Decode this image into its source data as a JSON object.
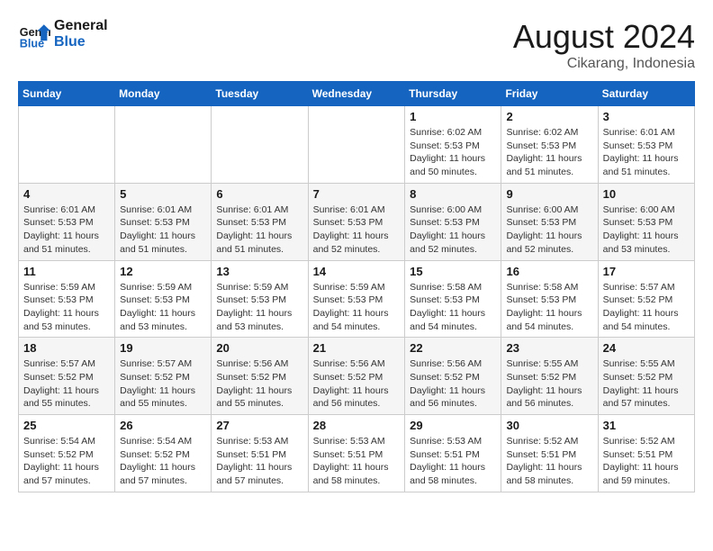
{
  "header": {
    "logo_line1": "General",
    "logo_line2": "Blue",
    "month_year": "August 2024",
    "location": "Cikarang, Indonesia"
  },
  "weekdays": [
    "Sunday",
    "Monday",
    "Tuesday",
    "Wednesday",
    "Thursday",
    "Friday",
    "Saturday"
  ],
  "weeks": [
    [
      {
        "day": "",
        "info": ""
      },
      {
        "day": "",
        "info": ""
      },
      {
        "day": "",
        "info": ""
      },
      {
        "day": "",
        "info": ""
      },
      {
        "day": "1",
        "info": "Sunrise: 6:02 AM\nSunset: 5:53 PM\nDaylight: 11 hours and 50 minutes."
      },
      {
        "day": "2",
        "info": "Sunrise: 6:02 AM\nSunset: 5:53 PM\nDaylight: 11 hours and 51 minutes."
      },
      {
        "day": "3",
        "info": "Sunrise: 6:01 AM\nSunset: 5:53 PM\nDaylight: 11 hours and 51 minutes."
      }
    ],
    [
      {
        "day": "4",
        "info": "Sunrise: 6:01 AM\nSunset: 5:53 PM\nDaylight: 11 hours and 51 minutes."
      },
      {
        "day": "5",
        "info": "Sunrise: 6:01 AM\nSunset: 5:53 PM\nDaylight: 11 hours and 51 minutes."
      },
      {
        "day": "6",
        "info": "Sunrise: 6:01 AM\nSunset: 5:53 PM\nDaylight: 11 hours and 51 minutes."
      },
      {
        "day": "7",
        "info": "Sunrise: 6:01 AM\nSunset: 5:53 PM\nDaylight: 11 hours and 52 minutes."
      },
      {
        "day": "8",
        "info": "Sunrise: 6:00 AM\nSunset: 5:53 PM\nDaylight: 11 hours and 52 minutes."
      },
      {
        "day": "9",
        "info": "Sunrise: 6:00 AM\nSunset: 5:53 PM\nDaylight: 11 hours and 52 minutes."
      },
      {
        "day": "10",
        "info": "Sunrise: 6:00 AM\nSunset: 5:53 PM\nDaylight: 11 hours and 53 minutes."
      }
    ],
    [
      {
        "day": "11",
        "info": "Sunrise: 5:59 AM\nSunset: 5:53 PM\nDaylight: 11 hours and 53 minutes."
      },
      {
        "day": "12",
        "info": "Sunrise: 5:59 AM\nSunset: 5:53 PM\nDaylight: 11 hours and 53 minutes."
      },
      {
        "day": "13",
        "info": "Sunrise: 5:59 AM\nSunset: 5:53 PM\nDaylight: 11 hours and 53 minutes."
      },
      {
        "day": "14",
        "info": "Sunrise: 5:59 AM\nSunset: 5:53 PM\nDaylight: 11 hours and 54 minutes."
      },
      {
        "day": "15",
        "info": "Sunrise: 5:58 AM\nSunset: 5:53 PM\nDaylight: 11 hours and 54 minutes."
      },
      {
        "day": "16",
        "info": "Sunrise: 5:58 AM\nSunset: 5:53 PM\nDaylight: 11 hours and 54 minutes."
      },
      {
        "day": "17",
        "info": "Sunrise: 5:57 AM\nSunset: 5:52 PM\nDaylight: 11 hours and 54 minutes."
      }
    ],
    [
      {
        "day": "18",
        "info": "Sunrise: 5:57 AM\nSunset: 5:52 PM\nDaylight: 11 hours and 55 minutes."
      },
      {
        "day": "19",
        "info": "Sunrise: 5:57 AM\nSunset: 5:52 PM\nDaylight: 11 hours and 55 minutes."
      },
      {
        "day": "20",
        "info": "Sunrise: 5:56 AM\nSunset: 5:52 PM\nDaylight: 11 hours and 55 minutes."
      },
      {
        "day": "21",
        "info": "Sunrise: 5:56 AM\nSunset: 5:52 PM\nDaylight: 11 hours and 56 minutes."
      },
      {
        "day": "22",
        "info": "Sunrise: 5:56 AM\nSunset: 5:52 PM\nDaylight: 11 hours and 56 minutes."
      },
      {
        "day": "23",
        "info": "Sunrise: 5:55 AM\nSunset: 5:52 PM\nDaylight: 11 hours and 56 minutes."
      },
      {
        "day": "24",
        "info": "Sunrise: 5:55 AM\nSunset: 5:52 PM\nDaylight: 11 hours and 57 minutes."
      }
    ],
    [
      {
        "day": "25",
        "info": "Sunrise: 5:54 AM\nSunset: 5:52 PM\nDaylight: 11 hours and 57 minutes."
      },
      {
        "day": "26",
        "info": "Sunrise: 5:54 AM\nSunset: 5:52 PM\nDaylight: 11 hours and 57 minutes."
      },
      {
        "day": "27",
        "info": "Sunrise: 5:53 AM\nSunset: 5:51 PM\nDaylight: 11 hours and 57 minutes."
      },
      {
        "day": "28",
        "info": "Sunrise: 5:53 AM\nSunset: 5:51 PM\nDaylight: 11 hours and 58 minutes."
      },
      {
        "day": "29",
        "info": "Sunrise: 5:53 AM\nSunset: 5:51 PM\nDaylight: 11 hours and 58 minutes."
      },
      {
        "day": "30",
        "info": "Sunrise: 5:52 AM\nSunset: 5:51 PM\nDaylight: 11 hours and 58 minutes."
      },
      {
        "day": "31",
        "info": "Sunrise: 5:52 AM\nSunset: 5:51 PM\nDaylight: 11 hours and 59 minutes."
      }
    ]
  ]
}
